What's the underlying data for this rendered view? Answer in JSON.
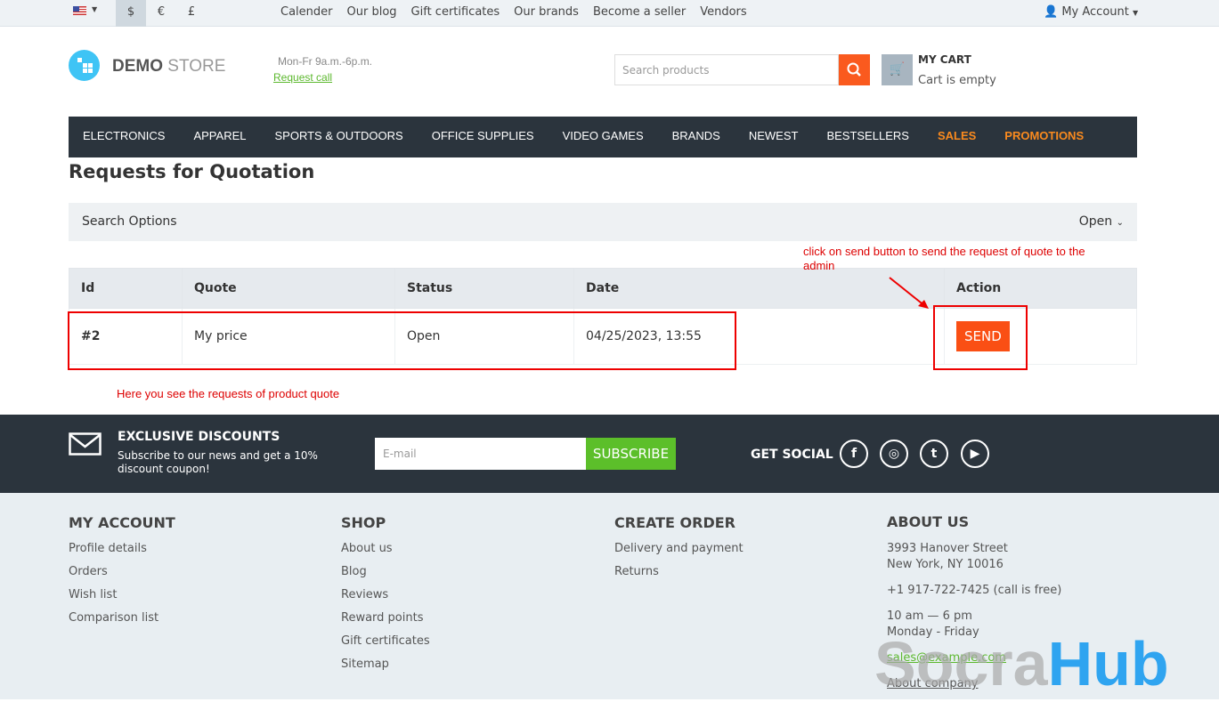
{
  "topbar": {
    "currencies": [
      "$",
      "€",
      "£"
    ],
    "links": [
      "Calender",
      "Our blog",
      "Gift certificates",
      "Our brands",
      "Become a seller",
      "Vendors"
    ],
    "account": "My Account"
  },
  "header": {
    "logo_bold": "DEMO",
    "logo_light": " STORE",
    "hours": "Mon-Fr 9a.m.-6p.m.",
    "request_call": "Request call",
    "search_placeholder": "Search products",
    "cart_title": "MY CART",
    "cart_status": "Cart is empty"
  },
  "nav": [
    {
      "label": "ELECTRONICS"
    },
    {
      "label": "APPAREL"
    },
    {
      "label": "SPORTS & OUTDOORS"
    },
    {
      "label": "OFFICE SUPPLIES"
    },
    {
      "label": "VIDEO GAMES"
    },
    {
      "label": "BRANDS"
    },
    {
      "label": "NEWEST"
    },
    {
      "label": "BESTSELLERS"
    },
    {
      "label": "SALES"
    },
    {
      "label": "PROMOTIONS"
    }
  ],
  "page": {
    "title": "Requests for Quotation",
    "search_options": "Search Options",
    "filter": "Open"
  },
  "table": {
    "headers": [
      "Id",
      "Quote",
      "Status",
      "Date",
      "Action"
    ],
    "rows": [
      {
        "id": "#2",
        "quote": "My price",
        "status": "Open",
        "date": "04/25/2023, 13:55",
        "action": "SEND"
      }
    ]
  },
  "annotations": {
    "send_note": "click on send button to send the request of quote to the admin",
    "rows_note": "Here you see the requests of product quote"
  },
  "newsletter": {
    "title": "EXCLUSIVE DISCOUNTS",
    "text": "Subscribe to our news and get a 10% discount coupon!",
    "placeholder": "E-mail",
    "button": "SUBSCRIBE",
    "social": "GET SOCIAL"
  },
  "footer": {
    "my_account": {
      "title": "MY ACCOUNT",
      "items": [
        "Profile details",
        "Orders",
        "Wish list",
        "Comparison list"
      ]
    },
    "shop": {
      "title": "SHOP",
      "items": [
        "About us",
        "Blog",
        "Reviews",
        "Reward points",
        "Gift certificates",
        "Sitemap"
      ]
    },
    "create_order": {
      "title": "CREATE ORDER",
      "items": [
        "Delivery and payment",
        "Returns"
      ]
    },
    "about": {
      "title": "ABOUT US",
      "address1": "3993 Hanover Street",
      "address2": "New York, NY 10016",
      "phone": "+1 917-722-7425 (call is free)",
      "hours1": "10 am — 6 pm",
      "hours2": "Monday - Friday",
      "email": "sales@example.com",
      "about_link": "About company"
    }
  },
  "watermark": {
    "part1": "Socra",
    "part2": "Hub"
  }
}
